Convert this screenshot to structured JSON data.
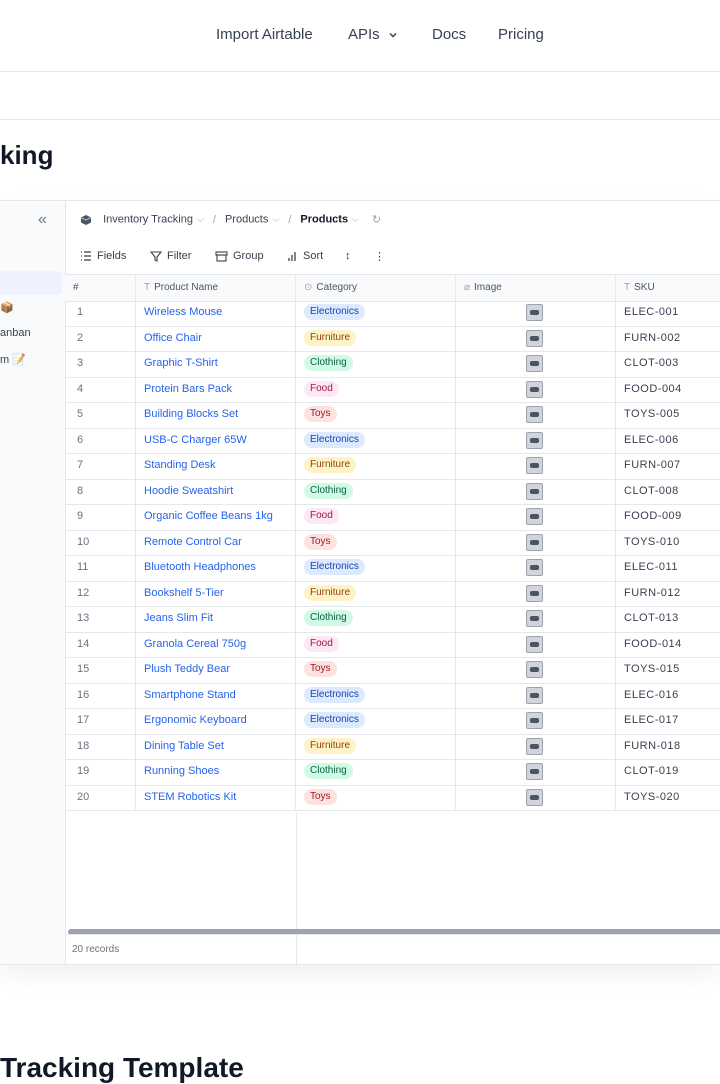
{
  "topnav": {
    "items": [
      "Import Airtable",
      "APIs",
      "Docs",
      "Pricing"
    ]
  },
  "page_title": "king",
  "bottom_title": "Tracking Template",
  "sidebar": {
    "items": [
      "📦",
      "anban",
      "m 📝"
    ]
  },
  "breadcrumb": {
    "base": "Inventory Tracking",
    "table": "Products",
    "view": "Products"
  },
  "toolbar": {
    "fields": "Fields",
    "filter": "Filter",
    "group": "Group",
    "sort": "Sort"
  },
  "grid": {
    "columns": [
      "#",
      "Product Name",
      "Category",
      "Image",
      "SKU"
    ],
    "category_colors": {
      "Electronics": {
        "bg": "#dbeafe",
        "fg": "#1e40af"
      },
      "Furniture": {
        "bg": "#fef3c7",
        "fg": "#92400e"
      },
      "Clothing": {
        "bg": "#d1fae5",
        "fg": "#065f46"
      },
      "Food": {
        "bg": "#fce7f3",
        "fg": "#9d174d"
      },
      "Toys": {
        "bg": "#fee2e2",
        "fg": "#991b1b"
      }
    },
    "rows": [
      {
        "n": "1",
        "name": "Wireless Mouse",
        "category": "Electronics",
        "sku": "ELEC-001"
      },
      {
        "n": "2",
        "name": "Office Chair",
        "category": "Furniture",
        "sku": "FURN-002"
      },
      {
        "n": "3",
        "name": "Graphic T-Shirt",
        "category": "Clothing",
        "sku": "CLOT-003"
      },
      {
        "n": "4",
        "name": "Protein Bars Pack",
        "category": "Food",
        "sku": "FOOD-004"
      },
      {
        "n": "5",
        "name": "Building Blocks Set",
        "category": "Toys",
        "sku": "TOYS-005"
      },
      {
        "n": "6",
        "name": "USB-C Charger 65W",
        "category": "Electronics",
        "sku": "ELEC-006"
      },
      {
        "n": "7",
        "name": "Standing Desk",
        "category": "Furniture",
        "sku": "FURN-007"
      },
      {
        "n": "8",
        "name": "Hoodie Sweatshirt",
        "category": "Clothing",
        "sku": "CLOT-008"
      },
      {
        "n": "9",
        "name": "Organic Coffee Beans 1kg",
        "category": "Food",
        "sku": "FOOD-009"
      },
      {
        "n": "10",
        "name": "Remote Control Car",
        "category": "Toys",
        "sku": "TOYS-010"
      },
      {
        "n": "11",
        "name": "Bluetooth Headphones",
        "category": "Electronics",
        "sku": "ELEC-011"
      },
      {
        "n": "12",
        "name": "Bookshelf 5-Tier",
        "category": "Furniture",
        "sku": "FURN-012"
      },
      {
        "n": "13",
        "name": "Jeans Slim Fit",
        "category": "Clothing",
        "sku": "CLOT-013"
      },
      {
        "n": "14",
        "name": "Granola Cereal 750g",
        "category": "Food",
        "sku": "FOOD-014"
      },
      {
        "n": "15",
        "name": "Plush Teddy Bear",
        "category": "Toys",
        "sku": "TOYS-015"
      },
      {
        "n": "16",
        "name": "Smartphone Stand",
        "category": "Electronics",
        "sku": "ELEC-016"
      },
      {
        "n": "17",
        "name": "Ergonomic Keyboard",
        "category": "Electronics",
        "sku": "ELEC-017"
      },
      {
        "n": "18",
        "name": "Dining Table Set",
        "category": "Furniture",
        "sku": "FURN-018"
      },
      {
        "n": "19",
        "name": "Running Shoes",
        "category": "Clothing",
        "sku": "CLOT-019"
      },
      {
        "n": "20",
        "name": "STEM Robotics Kit",
        "category": "Toys",
        "sku": "TOYS-020"
      }
    ]
  },
  "footer": {
    "record_count": "20 records"
  }
}
